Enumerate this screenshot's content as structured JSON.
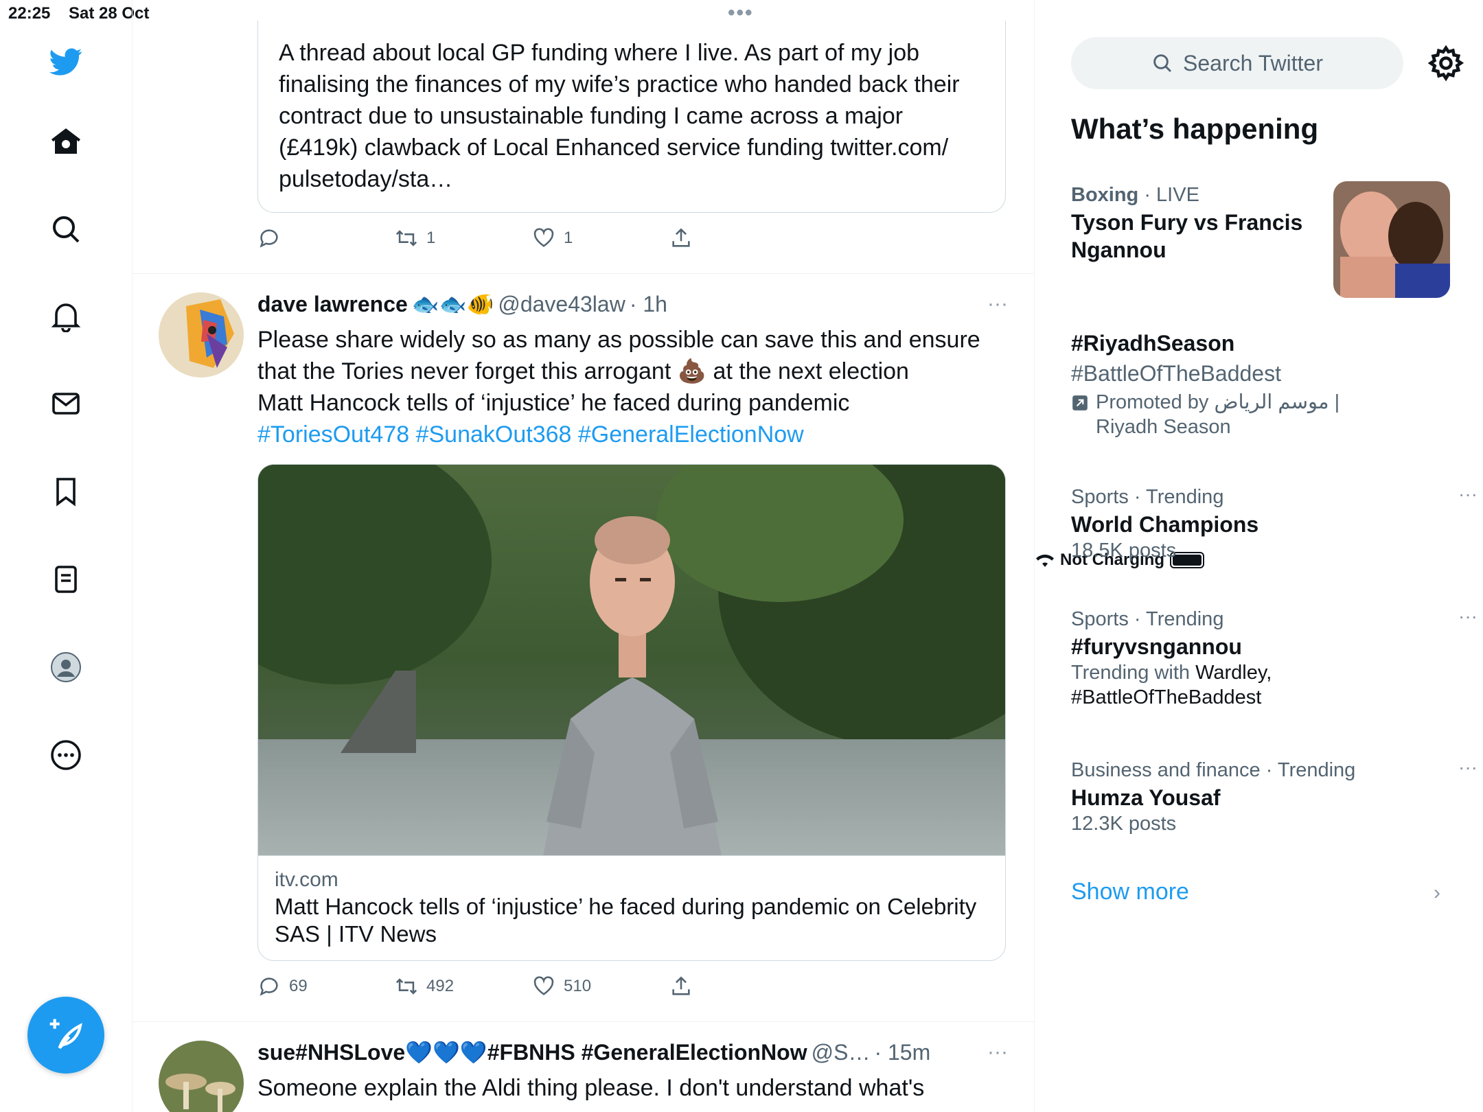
{
  "status": {
    "time": "22:25",
    "date": "Sat 28 Oct",
    "charging": "Not Charging"
  },
  "quoted": {
    "text": "A thread about local GP funding where I live. As part of my job finalising the finances of my wife’s practice who handed back their contract due to unsustainable funding I came across a major (£419k) clawback of Local Enhanced service funding twitter.com/ pulsetoday/sta…"
  },
  "tweet0_actions": {
    "reply": "",
    "retweet": "1",
    "like": "1"
  },
  "tweet1": {
    "name": "dave lawrence",
    "emoji": "🐟🐟🐠",
    "handle": "@dave43law",
    "time": "· 1h",
    "more": "···",
    "line1": "Please share widely so as many as possible can save this and ensure",
    "line2a": "that the Tories never forget this arrogant",
    "line2emoji": "💩",
    "line2b": "at the next election",
    "line3": "Matt Hancock tells of ‘injustice’ he faced during pandemic",
    "hashtags": "#ToriesOut478 #SunakOut368 #GeneralElectionNow",
    "link_domain": "itv.com",
    "link_title": "Matt Hancock tells of ‘injustice’ he faced during pandemic on Celebrity SAS | ITV News",
    "reply": "69",
    "retweet": "492",
    "like": "510"
  },
  "tweet2": {
    "name": "sue#NHSLove💙💙💙#FBNHS #GeneralElectionNow",
    "handle": "@S…",
    "time": "· 15m",
    "more": "···",
    "text": "Someone explain the Aldi thing please. I don't understand what's"
  },
  "right": {
    "search_placeholder": "Search Twitter",
    "section_title": "What’s happening",
    "trends": [
      {
        "category": "Boxing",
        "status": "· LIVE",
        "title": "Tyson Fury vs Francis Ngannou"
      },
      {
        "title": "#RiyadhSeason",
        "sub": "#BattleOfTheBaddest",
        "promoted": "Promoted by موسم الرياض | Riyadh Season"
      },
      {
        "category": "Sports · Trending",
        "title": "World Champions",
        "sub": "18.5K posts"
      },
      {
        "category": "Sports · Trending",
        "title": "#furyvsngannou",
        "sub_prefix": "Trending with",
        "sub": "Wardley, #BattleOfTheBaddest"
      },
      {
        "category": "Business and finance · Trending",
        "title": "Humza Yousaf",
        "sub": "12.3K posts"
      }
    ],
    "show_more": "Show more"
  },
  "colors": {
    "accent": "#1d9bf0",
    "text": "#0f1419",
    "muted": "#536471"
  }
}
